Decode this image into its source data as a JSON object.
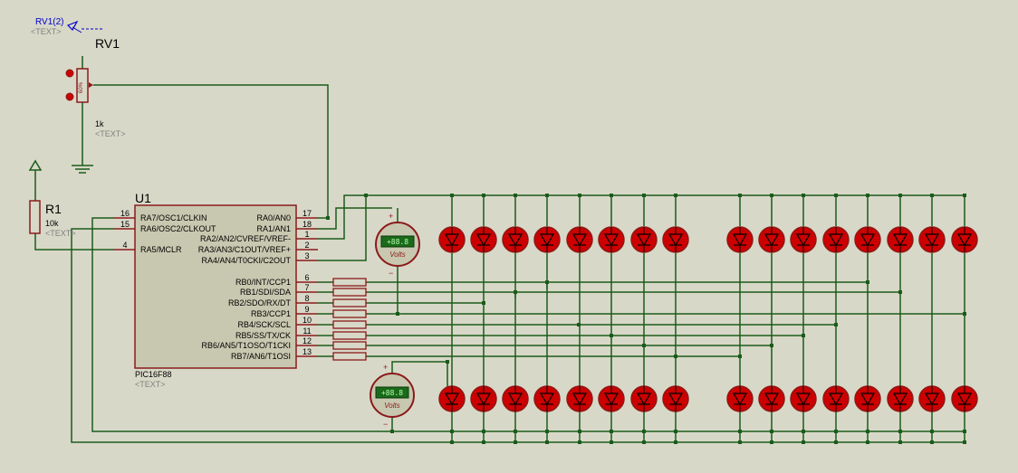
{
  "canvas": {
    "background": "#d8d8c8",
    "wire_color": "#1a5c1a",
    "component_color": "#8b1a1a",
    "led_fill": "#cc0000",
    "ic_fill": "#c8c8b0",
    "label_color": "#000000",
    "placeholder_color": "#808080",
    "probe_color": "#0000cc"
  },
  "probe": {
    "label": "RV1(2)",
    "text": "<TEXT>"
  },
  "rv1": {
    "ref": "RV1",
    "value": "1k",
    "text": "<TEXT>",
    "percent": "60%"
  },
  "r1": {
    "ref": "R1",
    "value": "10k",
    "text": "<TEXT>"
  },
  "u1": {
    "ref": "U1",
    "part": "PIC16F88",
    "text": "<TEXT>",
    "left_pins": [
      {
        "num": "16",
        "name": "RA7/OSC1/CLKIN"
      },
      {
        "num": "15",
        "name": "RA6/OSC2/CLKOUT"
      },
      {
        "num": "4",
        "name": "RA5/MCLR"
      }
    ],
    "right_pins": [
      {
        "num": "17",
        "name": "RA0/AN0"
      },
      {
        "num": "18",
        "name": "RA1/AN1"
      },
      {
        "num": "1",
        "name": "RA2/AN2/CVREF/VREF-"
      },
      {
        "num": "2",
        "name": "RA3/AN3/C1OUT/VREF+"
      },
      {
        "num": "3",
        "name": "RA4/AN4/T0CKI/C2OUT"
      },
      {
        "num": "6",
        "name": "RB0/INT/CCP1"
      },
      {
        "num": "7",
        "name": "RB1/SDI/SDA"
      },
      {
        "num": "8",
        "name": "RB2/SDO/RX/DT"
      },
      {
        "num": "9",
        "name": "RB3/CCP1"
      },
      {
        "num": "10",
        "name": "RB4/SCK/SCL"
      },
      {
        "num": "11",
        "name": "RB5/SS/TX/CK"
      },
      {
        "num": "12",
        "name": "RB6/AN5/T1OSO/T1CKI"
      },
      {
        "num": "13",
        "name": "RB7/AN6/T1OSI"
      }
    ]
  },
  "voltmeters": [
    {
      "display": "+88.8",
      "unit": "Volts",
      "plus": "+",
      "minus": "−"
    },
    {
      "display": "+88.8",
      "unit": "Volts",
      "plus": "+",
      "minus": "−"
    }
  ]
}
